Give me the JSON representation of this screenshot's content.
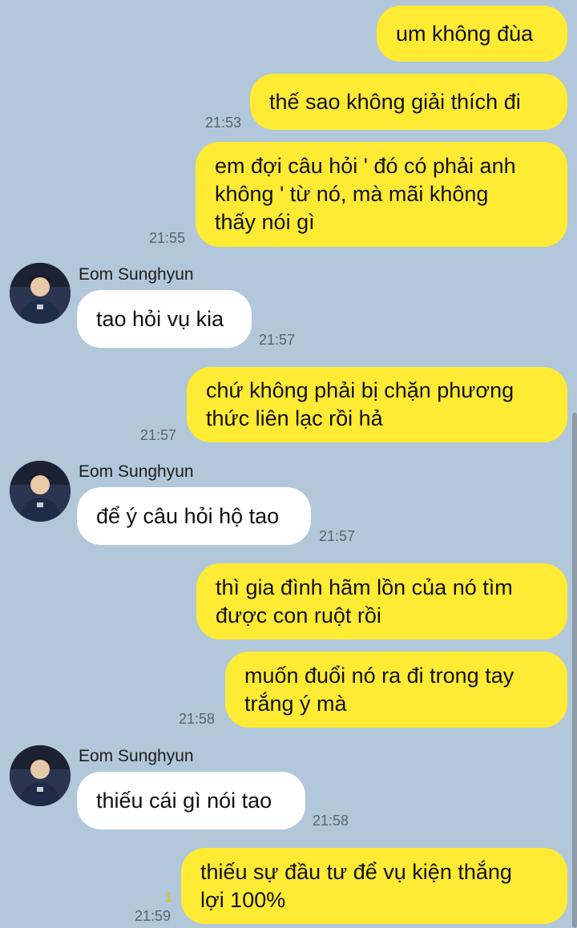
{
  "contact": {
    "name": "Eom Sunghyun"
  },
  "messages": [
    {
      "text": "um không đùa",
      "time": ""
    },
    {
      "text": "thế sao không giải thích đi",
      "time": "21:53"
    },
    {
      "text": "em đợi câu hỏi ' đó có phải anh\nkhông ' từ nó, mà mãi không\nthấy nói gì",
      "time": "21:55"
    },
    {
      "text": "tao hỏi vụ kia",
      "time": "21:57"
    },
    {
      "text": "chứ không phải bị chặn phương\nthức liên lạc rồi hả",
      "time": "21:57"
    },
    {
      "text": "để ý câu hỏi hộ tao",
      "time": "21:57"
    },
    {
      "text": "thì gia đình hãm lồn của nó tìm\nđược con ruột rồi",
      "time": ""
    },
    {
      "text": "muốn đuổi nó ra đi trong tay\ntrắng ý mà",
      "time": "21:58"
    },
    {
      "text": "thiếu cái gì nói tao",
      "time": "21:58"
    },
    {
      "text": "thiếu sự đầu tư để vụ kiện thắng\nlợi 100%",
      "time": "21:59",
      "unread": "1"
    }
  ],
  "colors": {
    "background": "#b2c7d9",
    "mine": "#ffeb33",
    "theirs": "#ffffff"
  }
}
